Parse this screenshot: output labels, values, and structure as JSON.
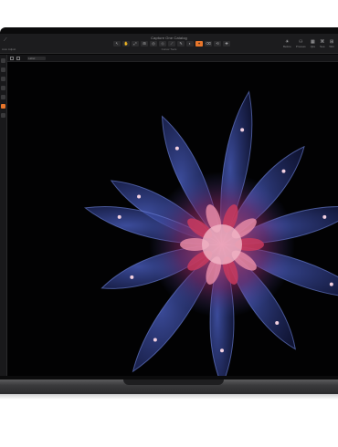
{
  "window": {
    "title": "Capture One Catalog"
  },
  "toolbar": {
    "left_label": "Auto Adjust",
    "center_label": "Cursor Tools",
    "tools": [
      "↖",
      "✋",
      "⤢",
      "⊞",
      "◎",
      "◇",
      "⟋",
      "✎",
      "◐",
      "✦",
      "⌫",
      "⟲",
      "✚"
    ],
    "active_tool_index": 9,
    "right_items": [
      {
        "icon": "☀",
        "label": "Before"
      },
      {
        "icon": "⚇",
        "label": "Process"
      },
      {
        "icon": "▦",
        "label": "Qks"
      },
      {
        "icon": "⌘",
        "label": "Sea"
      },
      {
        "icon": "⊞",
        "label": "Wkr"
      }
    ]
  },
  "viewer": {
    "field": "Label"
  },
  "colors": {
    "accent": "#e8762b",
    "jelly_outer": "#3b4ea8",
    "jelly_inner": "#d4436a"
  }
}
